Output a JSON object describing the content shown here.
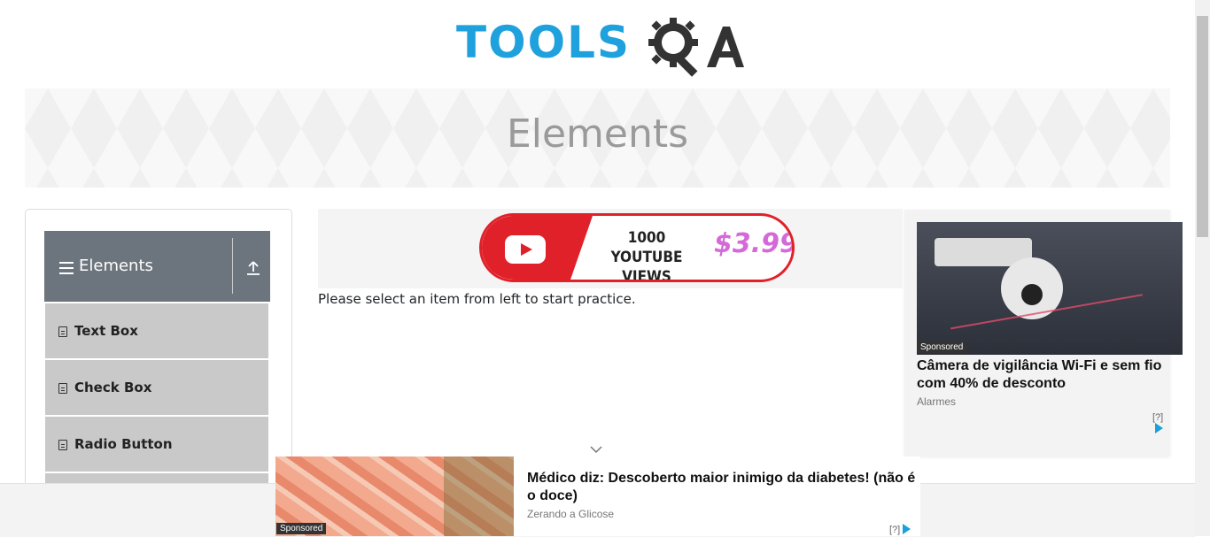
{
  "colors": {
    "logo_blue": "#1ea1dd",
    "logo_dark": "#333333",
    "header_gray": "#6c757d",
    "item_gray": "#c9c9c9",
    "ad_red": "#e0212a",
    "ad_price": "#d36ad8"
  },
  "header": {
    "logo_text": "TOOLS",
    "logo_suffix": "QA",
    "logo_icon": "gear-magnifier-icon"
  },
  "banner": {
    "title": "Elements"
  },
  "sidebar": {
    "group": {
      "label": "Elements",
      "menu_icon": "hamburger-icon",
      "collapse_icon": "upload-arrow-icon"
    },
    "items": [
      {
        "label": "Text Box",
        "icon": "document-icon"
      },
      {
        "label": "Check Box",
        "icon": "document-icon"
      },
      {
        "label": "Radio Button",
        "icon": "document-icon"
      }
    ]
  },
  "main": {
    "promo": {
      "views_line1": "1000",
      "views_line2": "YOUTUBE VIEWS",
      "price": "$3.99"
    },
    "instruction": "Please select an item from left to start practice."
  },
  "right_ad": {
    "tag": "Sponsored",
    "headline": "Câmera de vigilância Wi-Fi e sem fio com 40% de desconto",
    "source": "Alarmes",
    "adchoice": "[?]"
  },
  "bottom_ad": {
    "tag": "Sponsored",
    "headline": "Médico diz: Descoberto maior inimigo da diabetes! (não é o doce)",
    "source": "Zerando a Glicose",
    "adchoice": "[?]"
  }
}
